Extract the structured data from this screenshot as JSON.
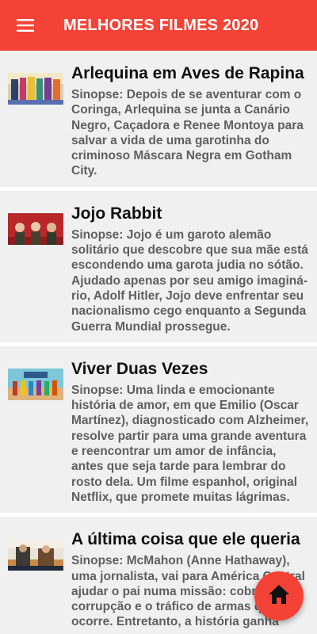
{
  "appbar": {
    "title": "MELHORES FILMES 2020",
    "menu_icon": "hamburger-menu-icon",
    "background_color": "#f44336"
  },
  "movies": [
    {
      "title": "Arlequina em Aves de Rapina",
      "synopsis": "Sinopse: Depois de se aventurar com o Coringa, Arlequina se junta a Canário Negro, Caçadora e Renee Montoya para salvar a vida de uma garotinha do criminoso Máscara Negra em Gotham City."
    },
    {
      "title": "Jojo Rabbit",
      "synopsis": "Sinopse: Jojo é um garoto alemão solitário que descobre que sua mãe está escondendo uma garota judia no sótão. Ajudado apenas por seu amigo imaginá-rio, Adolf Hitler, Jojo deve enfrentar seu nacionalismo cego enquanto a Segunda Guerra Mundial prossegue."
    },
    {
      "title": "Viver Duas Vezes",
      "synopsis": "Sinopse: Uma linda e emocionante história de amor, em que Emilio (Oscar Martínez), diagnosticado com Alzheimer, resolve partir para uma grande aventura e reencontrar um amor de infância, antes que seja tarde para lembrar do rosto dela. Um filme espanhol, original Netflix, que promete muitas lágrimas."
    },
    {
      "title": "A última coisa que ele queria",
      "synopsis": "Sinopse: McMahon (Anne Hathaway), uma jornalista, vai para América Central ajudar o pai numa missão: cobrir a corrupção e o tráfico de armas que ocorre. Entretanto, a história ganha"
    }
  ],
  "fab": {
    "icon": "home-icon",
    "color": "#f44336"
  }
}
